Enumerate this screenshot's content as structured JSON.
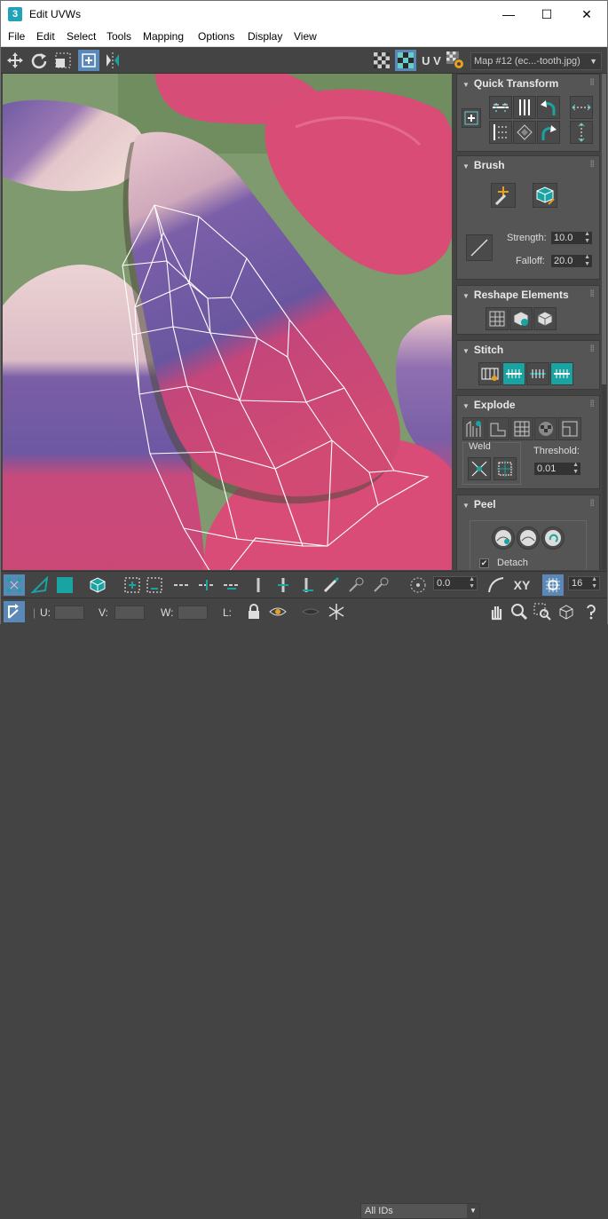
{
  "window": {
    "title": "Edit UVWs",
    "app_icon": "3",
    "controls": [
      "—",
      "☐",
      "✕"
    ]
  },
  "menu": [
    "File",
    "Edit",
    "Select",
    "Tools",
    "Mapping",
    "Options",
    "Display",
    "View"
  ],
  "toolbar": {
    "uv_label": "U V",
    "map_selection": "Map #12 (ec...-tooth.jpg)"
  },
  "panel": {
    "quick_transform": {
      "title": "Quick Transform"
    },
    "brush": {
      "title": "Brush",
      "strength_label": "Strength:",
      "strength_value": "10.0",
      "falloff_label": "Falloff:",
      "falloff_value": "20.0"
    },
    "reshape": {
      "title": "Reshape Elements"
    },
    "stitch": {
      "title": "Stitch"
    },
    "explode": {
      "title": "Explode",
      "weld_label": "Weld",
      "threshold_label": "Threshold:",
      "threshold_value": "0.01"
    },
    "peel": {
      "title": "Peel",
      "detach_label": "Detach",
      "detach_checked": true
    }
  },
  "bottom": {
    "rotation_value": "0.0",
    "xy_label": "XY",
    "grid_value": "16",
    "u_label": "U:",
    "v_label": "V:",
    "w_label": "W:",
    "l_label": "L:",
    "ids_selection": "All IDs"
  },
  "colors": {
    "accent": "#1aa3a3",
    "active": "#5a89b8",
    "panel": "#444444",
    "wire": "#ffffff"
  }
}
